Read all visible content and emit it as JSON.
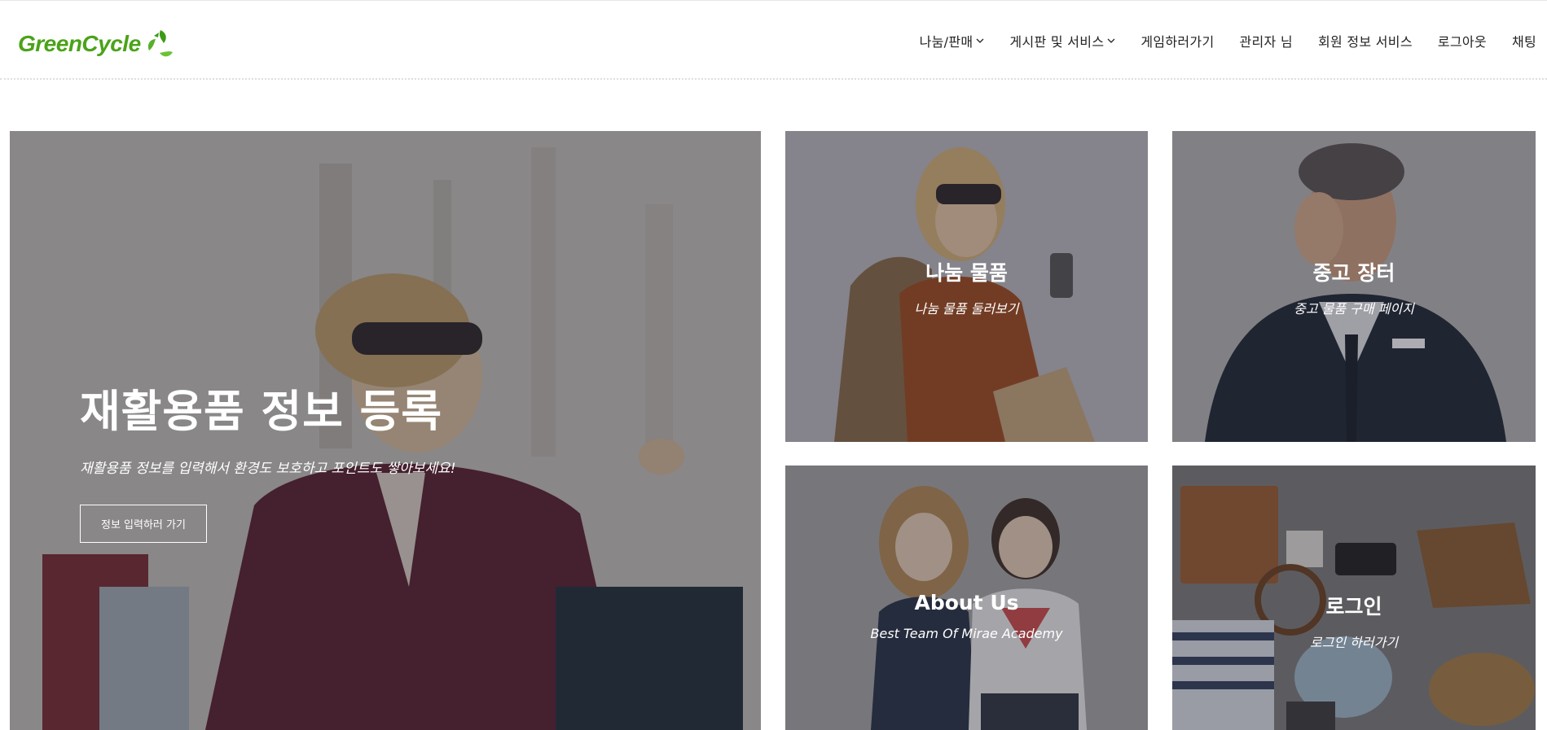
{
  "header": {
    "logo_text": "GreenCycle",
    "nav": [
      {
        "label": "나눔/판매",
        "dropdown": true
      },
      {
        "label": "게시판 및 서비스",
        "dropdown": true
      },
      {
        "label": "게임하러가기",
        "dropdown": false
      },
      {
        "label": "관리자 님",
        "dropdown": false
      },
      {
        "label": "회원 정보 서비스",
        "dropdown": false
      },
      {
        "label": "로그아웃",
        "dropdown": false
      },
      {
        "label": "채팅",
        "dropdown": false
      }
    ]
  },
  "hero": {
    "title": "재활용품 정보 등록",
    "subtitle": "재활용품 정보를 입력해서 환경도 보호하고 포인트도 쌓아보세요!",
    "button": "정보 입력하러 가기"
  },
  "tiles": [
    {
      "title": "나눔 물품",
      "subtitle": "나눔 물품 둘러보기"
    },
    {
      "title": "중고 장터",
      "subtitle": "중고 물품 구매 페이지"
    },
    {
      "title": "About Us",
      "subtitle": "Best Team Of Mirae Academy"
    },
    {
      "title": "로그인",
      "subtitle": "로그인 하러가기"
    }
  ],
  "colors": {
    "brand": "#4aa318",
    "overlay": "rgba(40,40,50,0.45)"
  }
}
